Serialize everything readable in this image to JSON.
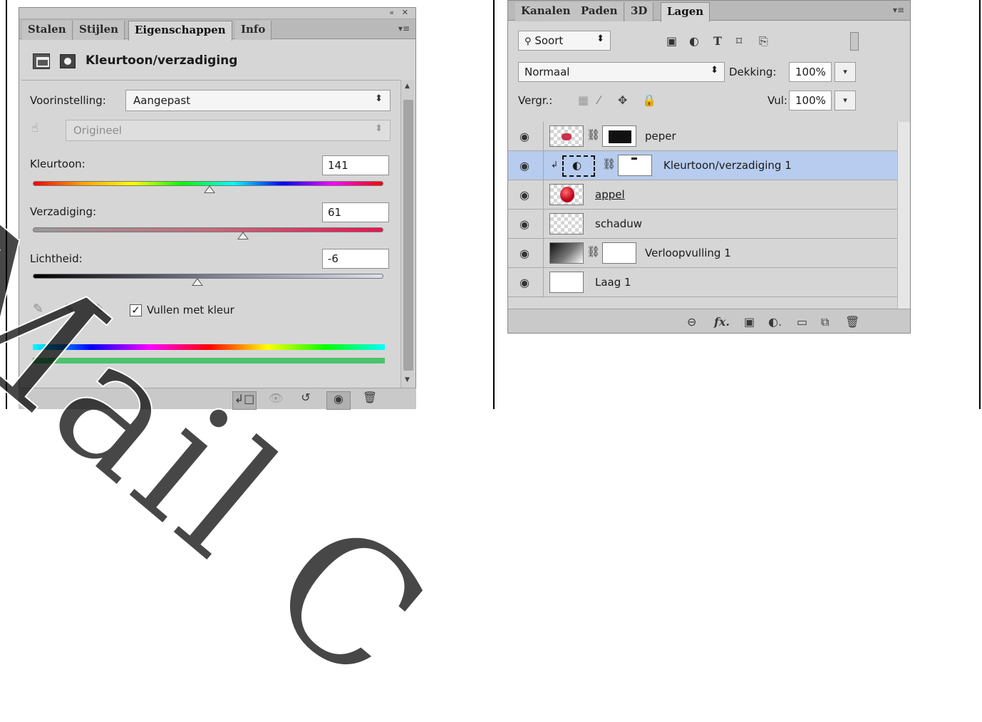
{
  "properties_panel": {
    "tabs": [
      {
        "label": "Stalen"
      },
      {
        "label": "Stijlen"
      },
      {
        "label": "Eigenschappen"
      },
      {
        "label": "Info"
      }
    ],
    "title": "Kleurtoon/verzadiging",
    "preset_label": "Voorinstelling:",
    "preset_value": "Aangepast",
    "channel_value": "Origineel",
    "hue": {
      "label": "Kleurtoon:",
      "value": "141",
      "level": 0.505
    },
    "saturation": {
      "label": "Verzadiging:",
      "value": "61",
      "level": 0.6
    },
    "lightness": {
      "label": "Lichtheid:",
      "value": "-6",
      "level": 0.47
    },
    "colorize": {
      "label": "Vullen met kleur",
      "checked": true
    }
  },
  "layers_panel": {
    "tabs": [
      {
        "label": "Kanalen"
      },
      {
        "label": "Paden"
      },
      {
        "label": "3D"
      },
      {
        "label": "Lagen"
      }
    ],
    "filter_value": "Soort",
    "blend_mode": "Normaal",
    "opacity_label": "Dekking:",
    "opacity_value": "100%",
    "lock_label": "Vergr.:",
    "fill_label": "Vul:",
    "fill_value": "100%",
    "layers": [
      {
        "name": "peper",
        "selected": false
      },
      {
        "name": "Kleurtoon/verzadiging 1",
        "selected": true
      },
      {
        "name": "appel",
        "selected": false
      },
      {
        "name": "schaduw",
        "selected": false
      },
      {
        "name": "Verloopvulling 1",
        "selected": false
      },
      {
        "name": "Laag 1",
        "selected": false
      }
    ]
  },
  "watermark": "Mail C",
  "colors": {
    "panel_bg": "#d6d6d6",
    "selected_layer": "#b7ccee"
  }
}
